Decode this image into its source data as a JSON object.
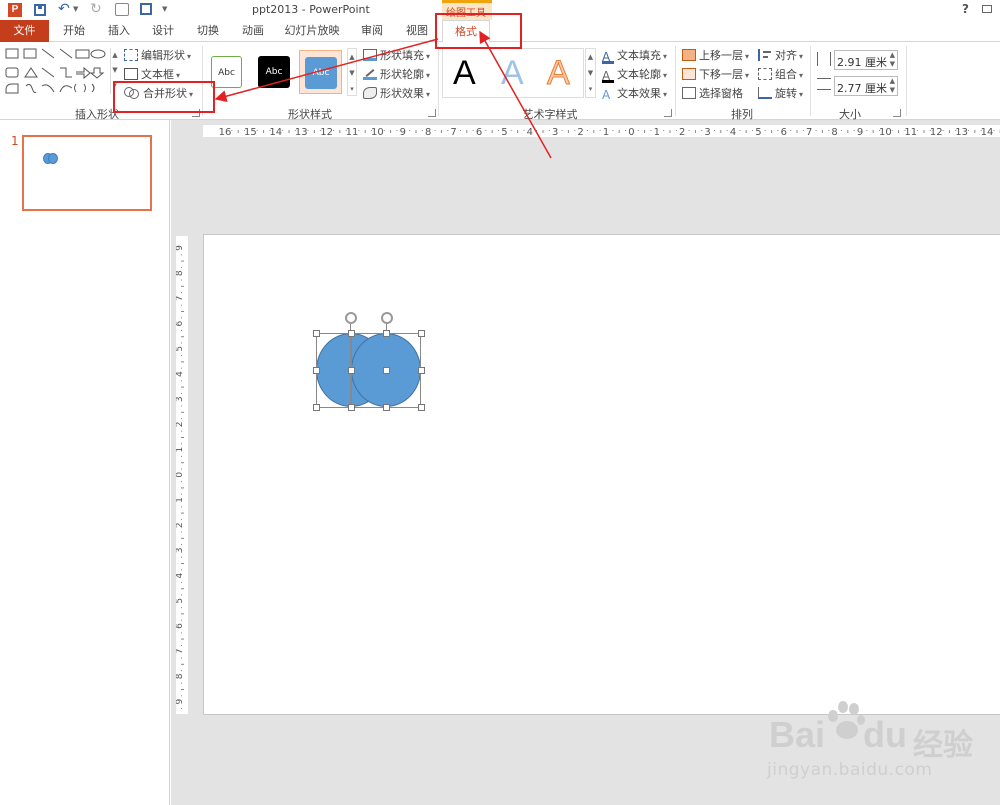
{
  "titlebar": {
    "title": "ppt2013 - PowerPoint",
    "context_tool_title": "绘图工具",
    "help": "?"
  },
  "tabs": {
    "file": "文件",
    "home": "开始",
    "insert": "插入",
    "design": "设计",
    "transitions": "切换",
    "animations": "动画",
    "slideshow": "幻灯片放映",
    "review": "审阅",
    "view": "视图",
    "format": "格式"
  },
  "ribbon": {
    "insert_shapes": {
      "label": "插入形状",
      "edit_shape": "编辑形状",
      "text_box": "文本框",
      "merge_shapes": "合并形状"
    },
    "shape_styles": {
      "label": "形状样式",
      "style_samples": [
        "Abc",
        "Abc",
        "Abc"
      ],
      "fill": "形状填充",
      "outline": "形状轮廓",
      "effects": "形状效果"
    },
    "wordart": {
      "label": "艺术字样式",
      "samples": [
        "A",
        "A",
        "A"
      ],
      "text_fill": "文本填充",
      "text_outline": "文本轮廓",
      "text_effects": "文本效果"
    },
    "arrange": {
      "label": "排列",
      "bring_forward": "上移一层",
      "send_backward": "下移一层",
      "selection_pane": "选择窗格",
      "align": "对齐",
      "group": "组合",
      "rotate": "旋转"
    },
    "size": {
      "label": "大小",
      "height": "2.91 厘米",
      "width": "2.77 厘米"
    }
  },
  "slides_pane": {
    "slide_number": "1"
  },
  "hruler_labels": [
    "16",
    "15",
    "14",
    "13",
    "12",
    "11",
    "10",
    "9",
    "8",
    "7",
    "6",
    "5",
    "4",
    "3",
    "2",
    "1",
    "0",
    "1",
    "2",
    "3",
    "4",
    "5",
    "6",
    "7",
    "8",
    "9",
    "10",
    "11",
    "12",
    "13",
    "14"
  ],
  "vruler_labels": [
    "9",
    "8",
    "7",
    "6",
    "5",
    "4",
    "3",
    "2",
    "1",
    "0",
    "1",
    "2",
    "3",
    "4",
    "5",
    "6",
    "7",
    "8",
    "9"
  ],
  "watermark": {
    "brand": "Bai",
    "brand_tail": "du",
    "brand_cn": "经验",
    "url": "jingyan.baidu.com"
  },
  "colors": {
    "file_tab_bg": "#c43e1c",
    "accent_orange": "#d24726",
    "context_orange": "#f0a30a",
    "circle_fill": "#5b9bd5",
    "annotation_red": "#e22222"
  }
}
